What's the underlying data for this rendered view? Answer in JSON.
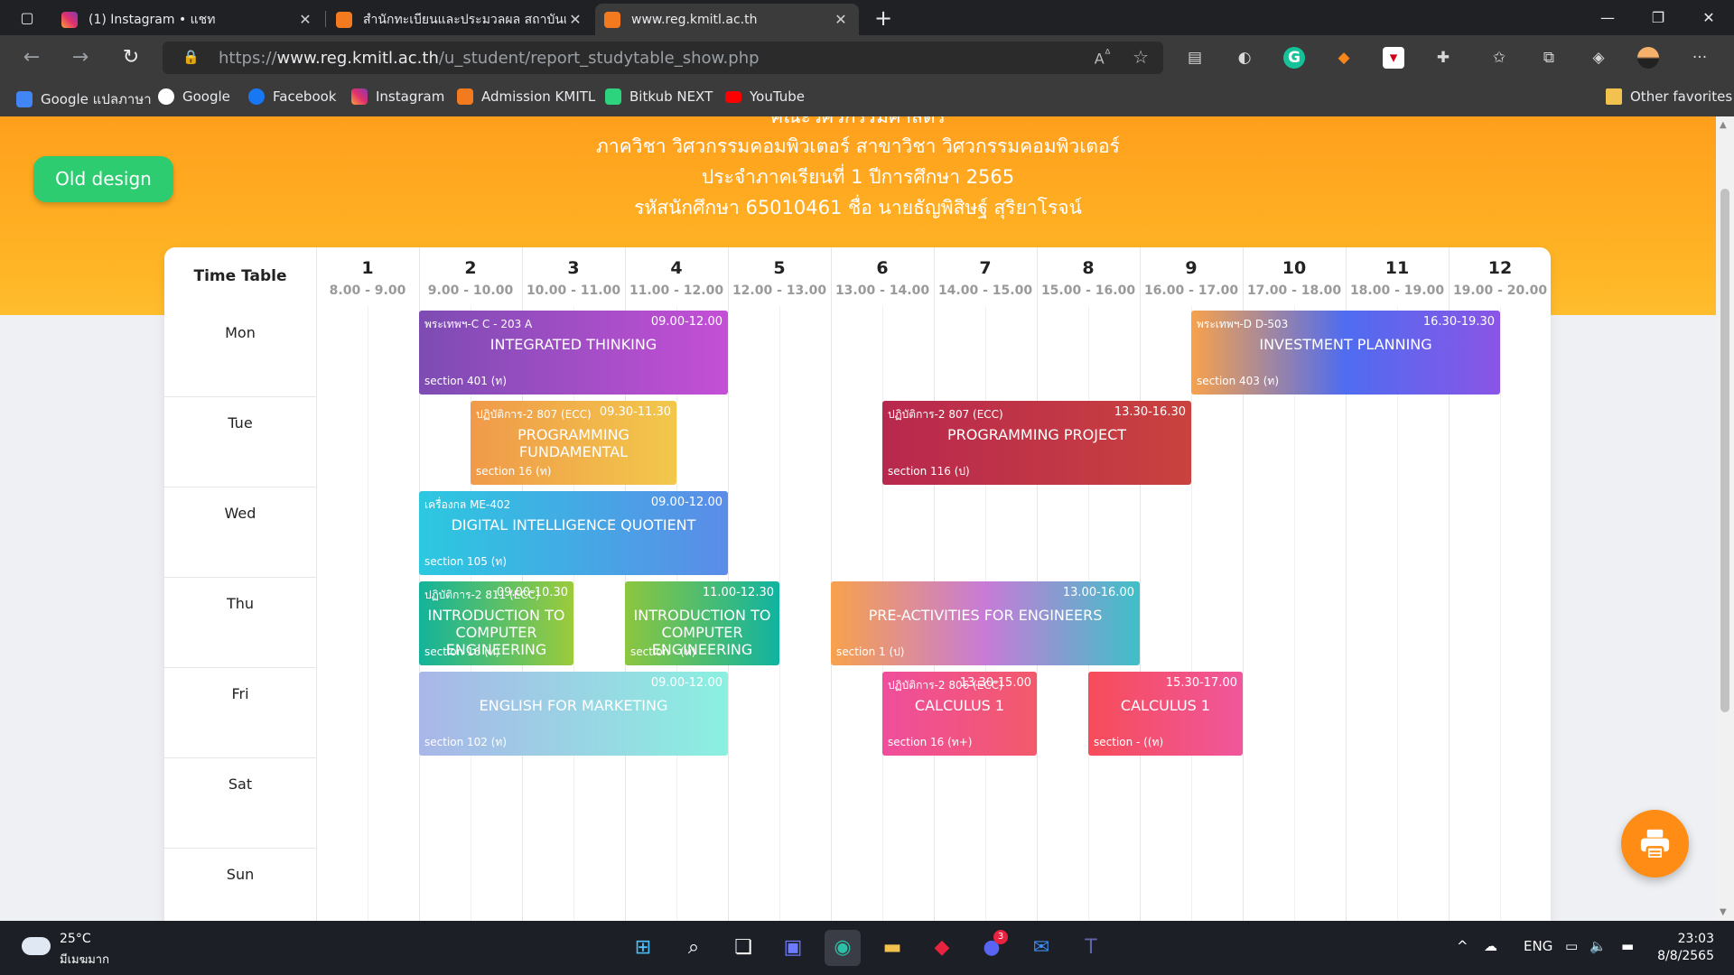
{
  "browser": {
    "tabs": [
      {
        "title": "(1) Instagram • แชท",
        "favicon": "instagram-icon",
        "active": false
      },
      {
        "title": "สำนักทะเบียนและประมวลผล สถาบันเทคโนโลยีพระจอมเกล้าเจ้าคุณทหารลาดกระบัง",
        "favicon": "kmitl-icon",
        "active": false
      },
      {
        "title": "www.reg.kmitl.ac.th",
        "favicon": "kmitl-icon",
        "active": true
      }
    ],
    "new_tab_label": "+",
    "url_prefix": "https://",
    "url_host": "www.reg.kmitl.ac.th",
    "url_path": "/u_student/report_studytable_show.php",
    "bookmarks": [
      {
        "label": "Google แปลภาษา",
        "icon": "google-translate-icon",
        "color": "#4285f4"
      },
      {
        "label": "Google",
        "icon": "google-icon",
        "color": "#ffffff"
      },
      {
        "label": "Facebook",
        "icon": "facebook-icon",
        "color": "#1877f2"
      },
      {
        "label": "Instagram",
        "icon": "instagram-icon",
        "color": "#e1306c"
      },
      {
        "label": "Admission KMITL",
        "icon": "kmitl-icon",
        "color": "#f47a20"
      },
      {
        "label": "Bitkub NEXT",
        "icon": "bitkub-icon",
        "color": "#2bd47d"
      },
      {
        "label": "YouTube",
        "icon": "youtube-icon",
        "color": "#ff0000"
      }
    ],
    "other_favorites": "Other favorites"
  },
  "header": {
    "line_partial": "คณะวิศวกรรมศาสตร์",
    "department": "ภาควิชา วิศวกรรมคอมพิวเตอร์   สาขาวิชา วิศวกรรมคอมพิวเตอร์",
    "semester": "ประจำภาคเรียนที่ 1    ปีการศึกษา 2565",
    "student": "รหัสนักศึกษา 65010461    ชื่อ นายธัญพิสิษฐ์ สุริยาโรจน์",
    "old_design_button": "Old design"
  },
  "timetable": {
    "corner_label": "Time Table",
    "periods": [
      {
        "num": "1",
        "time": "8.00 - 9.00"
      },
      {
        "num": "2",
        "time": "9.00 - 10.00"
      },
      {
        "num": "3",
        "time": "10.00 - 11.00"
      },
      {
        "num": "4",
        "time": "11.00 - 12.00"
      },
      {
        "num": "5",
        "time": "12.00 - 13.00"
      },
      {
        "num": "6",
        "time": "13.00 - 14.00"
      },
      {
        "num": "7",
        "time": "14.00 - 15.00"
      },
      {
        "num": "8",
        "time": "15.00 - 16.00"
      },
      {
        "num": "9",
        "time": "16.00 - 17.00"
      },
      {
        "num": "10",
        "time": "17.00 - 18.00"
      },
      {
        "num": "11",
        "time": "18.00 - 19.00"
      },
      {
        "num": "12",
        "time": "19.00 - 20.00"
      }
    ],
    "days": [
      "Mon",
      "Tue",
      "Wed",
      "Thu",
      "Fri",
      "Sat",
      "Sun"
    ],
    "classes": [
      {
        "day": "Mon",
        "start": 9.0,
        "end": 12.0,
        "room": "พระเทพฯ-C C - 203 A",
        "time": "09.00-12.00",
        "name": "INTEGRATED THINKING",
        "section": "section 401 (ท)",
        "colors": [
          "#7d4cb3",
          "#c44fd6"
        ]
      },
      {
        "day": "Mon",
        "start": 16.5,
        "end": 19.5,
        "room": "พระเทพฯ-D D-503",
        "time": "16.30-19.30",
        "name": "INVESTMENT PLANNING",
        "section": "section 403 (ท)",
        "colors": [
          "#f7a24c",
          "#4f6cf0",
          "#8a55e6"
        ]
      },
      {
        "day": "Tue",
        "start": 9.5,
        "end": 11.5,
        "room": "ปฏิบัติการ-2 807 (ECC)",
        "time": "09.30-11.30",
        "name": "PROGRAMMING FUNDAMENTAL",
        "section": "section 16 (ท)",
        "colors": [
          "#f09a4a",
          "#f2c84b"
        ]
      },
      {
        "day": "Tue",
        "start": 13.5,
        "end": 16.5,
        "room": "ปฏิบัติการ-2 807 (ECC)",
        "time": "13.30-16.30",
        "name": "PROGRAMMING PROJECT",
        "section": "section 116 (ป)",
        "colors": [
          "#b8284e",
          "#c9423e"
        ]
      },
      {
        "day": "Wed",
        "start": 9.0,
        "end": 12.0,
        "room": "เครื่องกล ME-402",
        "time": "09.00-12.00",
        "name": "DIGITAL INTELLIGENCE QUOTIENT",
        "section": "section 105 (ท)",
        "colors": [
          "#2cc8e0",
          "#5b8ce8"
        ]
      },
      {
        "day": "Thu",
        "start": 9.0,
        "end": 10.5,
        "room": "ปฏิบัติการ-2 811 (ECC)",
        "time": "09.00-10.30",
        "name": "INTRODUCTION TO COMPUTER ENGINEERING",
        "section": "section 16 (ท)",
        "colors": [
          "#13b39a",
          "#9ccb3b"
        ]
      },
      {
        "day": "Thu",
        "start": 11.0,
        "end": 12.5,
        "room": "",
        "time": "11.00-12.30",
        "name": "INTRODUCTION TO COMPUTER ENGINEERING",
        "section": "section - (ท)",
        "colors": [
          "#8cc63f",
          "#10b3a0"
        ]
      },
      {
        "day": "Thu",
        "start": 13.0,
        "end": 16.0,
        "room": "",
        "time": "13.00-16.00",
        "name": "PRE-ACTIVITIES FOR ENGINEERS",
        "section": "section 1 (ป)",
        "colors": [
          "#f7a24c",
          "#c77bd7",
          "#3fc0c8"
        ]
      },
      {
        "day": "Fri",
        "start": 9.0,
        "end": 12.0,
        "room": "",
        "time": "09.00-12.00",
        "name": "ENGLISH FOR MARKETING",
        "section": "section 102 (ท)",
        "colors": [
          "#a9b6e8",
          "#8af0e0"
        ]
      },
      {
        "day": "Fri",
        "start": 13.5,
        "end": 15.0,
        "room": "ปฏิบัติการ-2 806 (ECC)",
        "time": "13.30-15.00",
        "name": "CALCULUS 1",
        "section": "section 16 (ท+)",
        "colors": [
          "#f04e9c",
          "#f25a6b"
        ]
      },
      {
        "day": "Fri",
        "start": 15.5,
        "end": 17.0,
        "room": "",
        "time": "15.30-17.00",
        "name": "CALCULUS 1",
        "section": "section - ((ท)",
        "colors": [
          "#f64c5a",
          "#f0579c"
        ]
      }
    ]
  },
  "taskbar": {
    "weather_temp": "25°C",
    "weather_desc": "มีเมฆมาก",
    "lang": "ENG",
    "time": "23:03",
    "date": "8/8/2565",
    "discord_badge": "3"
  }
}
